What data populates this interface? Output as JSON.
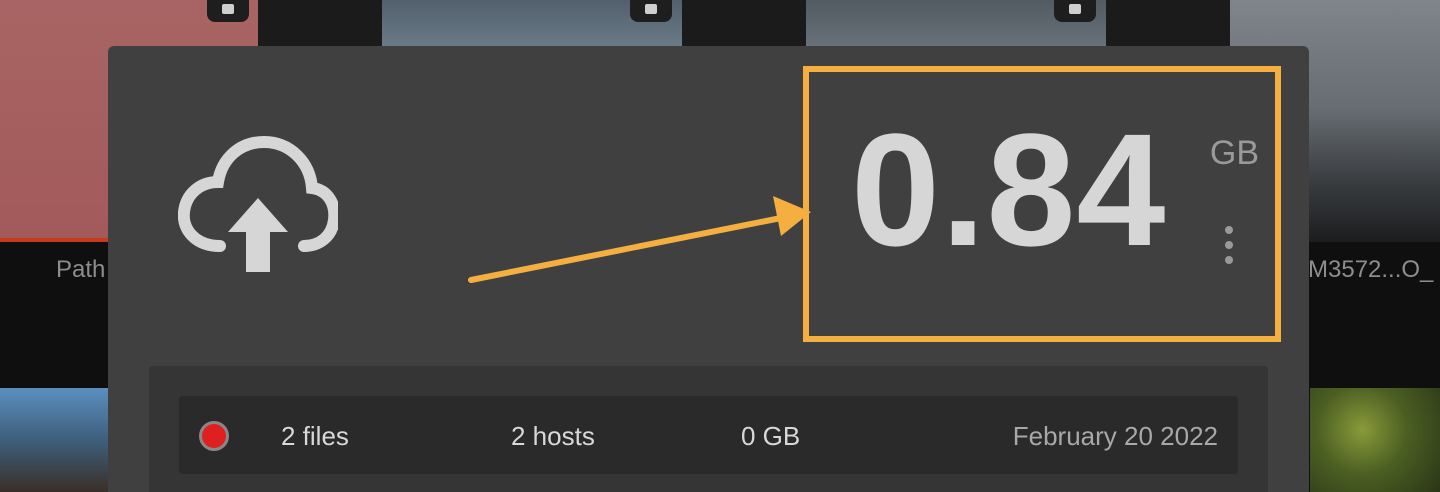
{
  "background": {
    "left_label": "Path",
    "right_label": "M3572...O_"
  },
  "stat": {
    "value": "0.84",
    "unit": "GB"
  },
  "colors": {
    "highlight": "#f5ae40",
    "status_dot": "#e02020"
  },
  "icons": {
    "upload": "cloud-upload-icon",
    "menu": "more-vertical-icon"
  },
  "info": {
    "files": "2 files",
    "hosts": "2 hosts",
    "size": "0 GB",
    "date": "February 20 2022"
  }
}
